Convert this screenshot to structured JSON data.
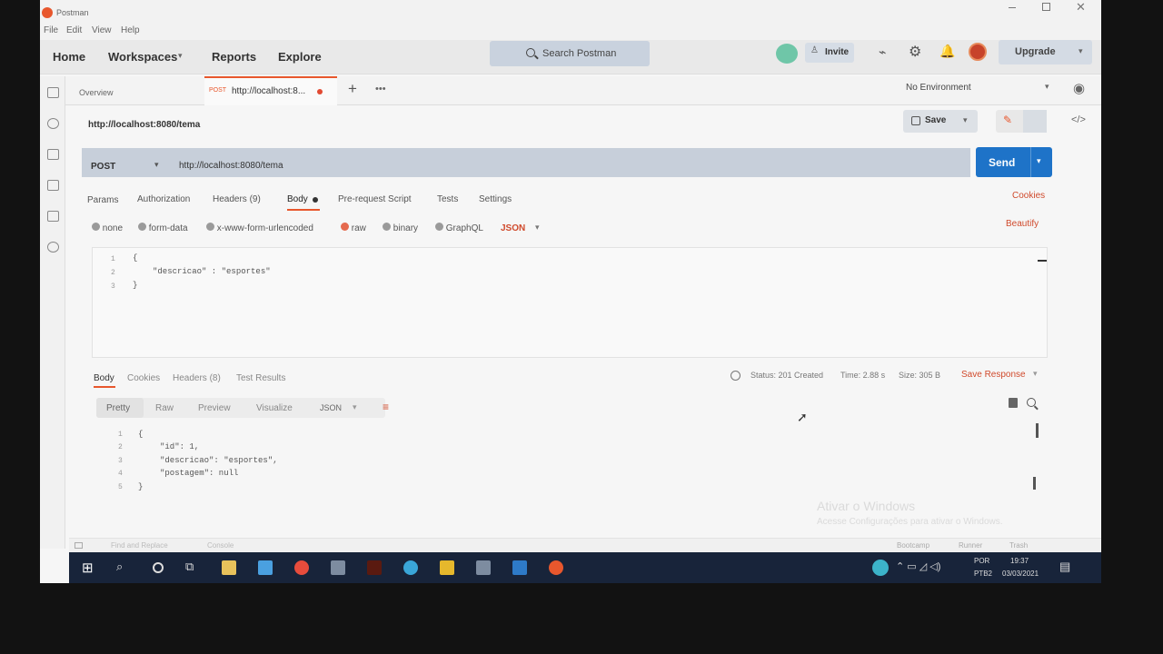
{
  "window": {
    "title": "Postman",
    "menu": [
      "File",
      "Edit",
      "View",
      "Help"
    ]
  },
  "header": {
    "nav": [
      "Home",
      "Workspaces",
      "Reports",
      "Explore"
    ],
    "search_placeholder": "Search Postman",
    "invite_label": "Invite",
    "upgrade_label": "Upgrade"
  },
  "tabs": {
    "overview_label": "Overview",
    "active_method": "POST",
    "active_url": "http://localhost:8...",
    "environment": "No Environment"
  },
  "request": {
    "name": "http://localhost:8080/tema",
    "save_label": "Save",
    "method": "POST",
    "url": "http://localhost:8080/tema",
    "send_label": "Send",
    "subtabs": [
      "Params",
      "Authorization",
      "Headers (9)",
      "Body",
      "Pre-request Script",
      "Tests",
      "Settings"
    ],
    "cookies_label": "Cookies",
    "beautify_label": "Beautify",
    "body_types": [
      "none",
      "form-data",
      "x-www-form-urlencoded",
      "raw",
      "binary",
      "GraphQL"
    ],
    "format": "JSON",
    "body_lines": [
      "1",
      "2",
      "3"
    ],
    "body_code": [
      "{",
      "\"descricao\" : \"esportes\"",
      "}"
    ]
  },
  "response": {
    "tabs": [
      "Body",
      "Cookies",
      "Headers (8)",
      "Test Results"
    ],
    "status": "Status: 201 Created",
    "time": "Time: 2.88 s",
    "size": "Size: 305 B",
    "save_response": "Save Response",
    "views": [
      "Pretty",
      "Raw",
      "Preview",
      "Visualize"
    ],
    "format": "JSON",
    "lines": [
      "1",
      "2",
      "3",
      "4",
      "5"
    ],
    "code": [
      "{",
      "\"id\": 1,",
      "\"descricao\": \"esportes\",",
      "\"postagem\": null",
      "}"
    ]
  },
  "footer": {
    "find_replace": "Find and Replace",
    "console": "Console",
    "bootcamp": "Bootcamp",
    "runner": "Runner",
    "trash": "Trash",
    "watermark_title": "Ativar o Windows",
    "watermark_sub": "Acesse Configurações para ativar o Windows."
  },
  "taskbar": {
    "lang": "POR",
    "layout": "PTB2",
    "time": "19:37",
    "date": "03/03/2021"
  },
  "colors": {
    "accent": "#e8572d",
    "send": "#1e73c8",
    "taskbar": "#18243a"
  }
}
